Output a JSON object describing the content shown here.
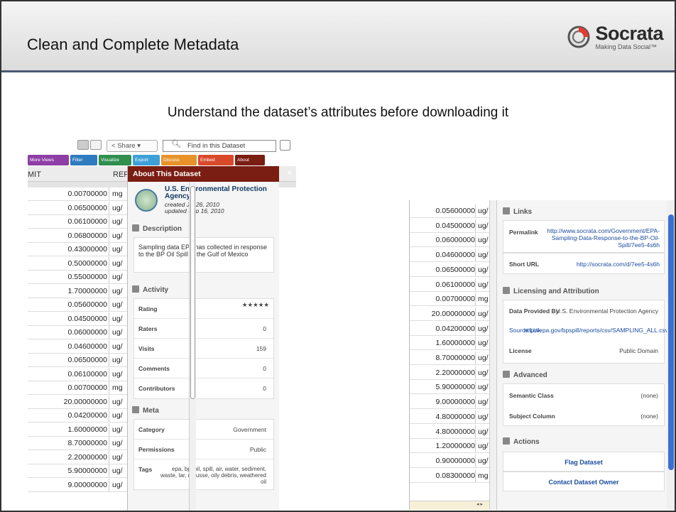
{
  "slide": {
    "title": "Clean and Complete Metadata",
    "subtitle": "Understand the dataset’s attributes before downloading it",
    "logo_name": "Socrata",
    "logo_tagline": "Making Data Social™"
  },
  "left_toolbar": {
    "share_label": "Share ▾",
    "find_placeholder": "Find in this Dataset",
    "buttons": [
      {
        "label": "More Views",
        "color": "#8e3fa5"
      },
      {
        "label": "Filter",
        "color": "#2f7bbf"
      },
      {
        "label": "Visualize",
        "color": "#2f8f4f"
      },
      {
        "label": "Export",
        "color": "#3ea0d8"
      },
      {
        "label": "Discuss",
        "color": "#e8932a"
      },
      {
        "label": "Embed",
        "color": "#d94a2b"
      },
      {
        "label": "About",
        "color": "#7a1d12"
      }
    ]
  },
  "left_table": {
    "col1": "MIT",
    "col2": "REF",
    "rows": [
      {
        "value": "0.00700000",
        "unit": "mg"
      },
      {
        "value": "0.06500000",
        "unit": "ug/"
      },
      {
        "value": "0.06100000",
        "unit": "ug/"
      },
      {
        "value": "0.06800000",
        "unit": "ug/"
      },
      {
        "value": "0.43000000",
        "unit": "ug/"
      },
      {
        "value": "0.50000000",
        "unit": "ug/"
      },
      {
        "value": "0.55000000",
        "unit": "ug/"
      },
      {
        "value": "1.70000000",
        "unit": "ug/"
      },
      {
        "value": "0.05600000",
        "unit": "ug/"
      },
      {
        "value": "0.04500000",
        "unit": "ug/"
      },
      {
        "value": "0.06000000",
        "unit": "ug/"
      },
      {
        "value": "0.04600000",
        "unit": "ug/"
      },
      {
        "value": "0.06500000",
        "unit": "ug/"
      },
      {
        "value": "0.06100000",
        "unit": "ug/"
      },
      {
        "value": "0.00700000",
        "unit": "mg"
      },
      {
        "value": "20.00000000",
        "unit": "ug/"
      },
      {
        "value": "0.04200000",
        "unit": "ug/"
      },
      {
        "value": "1.60000000",
        "unit": "ug/"
      },
      {
        "value": "8.70000000",
        "unit": "ug/"
      },
      {
        "value": "2.20000000",
        "unit": "ug/"
      },
      {
        "value": "5.90000000",
        "unit": "ug/"
      },
      {
        "value": "9.00000000",
        "unit": "ug/"
      }
    ]
  },
  "about": {
    "heading": "About This Dataset",
    "close": "×",
    "agency_name": "U.S. Environmental Protection Agency",
    "created": "created Jul 26, 2010",
    "updated": "updated Sep 16, 2010",
    "description_heading": "Description",
    "description": "Sampling data EPA has collected in response to the BP Oil Spill in the Gulf of Mexico",
    "activity_heading": "Activity",
    "rating_label": "Rating",
    "rating_stars": "★★★★★",
    "raters_label": "Raters",
    "raters": "0",
    "visits_label": "Visits",
    "visits": "159",
    "comments_label": "Comments",
    "comments": "0",
    "contributors_label": "Contributors",
    "contributors": "0",
    "meta_heading": "Meta",
    "category_label": "Category",
    "category": "Government",
    "permissions_label": "Permissions",
    "permissions": "Public",
    "tags_label": "Tags",
    "tags": "epa, bp, oil, spill, air, water, sediment, waste, tar, mousse, oily debris, weathered oil"
  },
  "right_table": {
    "rows": [
      {
        "value": "0.05600000",
        "unit": "ug/"
      },
      {
        "value": "0.04500000",
        "unit": "ug/"
      },
      {
        "value": "0.06000000",
        "unit": "ug/"
      },
      {
        "value": "0.04600000",
        "unit": "ug/"
      },
      {
        "value": "0.06500000",
        "unit": "ug/"
      },
      {
        "value": "0.06100000",
        "unit": "ug/"
      },
      {
        "value": "0.00700000",
        "unit": "mg"
      },
      {
        "value": "20.00000000",
        "unit": "ug/"
      },
      {
        "value": "0.04200000",
        "unit": "ug/"
      },
      {
        "value": "1.60000000",
        "unit": "ug/"
      },
      {
        "value": "8.70000000",
        "unit": "ug/"
      },
      {
        "value": "2.20000000",
        "unit": "ug/"
      },
      {
        "value": "5.90000000",
        "unit": "ug/"
      },
      {
        "value": "9.00000000",
        "unit": "ug/"
      },
      {
        "value": "4.80000000",
        "unit": "ug/"
      },
      {
        "value": "4.80000000",
        "unit": "ug/"
      },
      {
        "value": "1.20000000",
        "unit": "ug/"
      },
      {
        "value": "0.90000000",
        "unit": "ug/"
      },
      {
        "value": "0.08300000",
        "unit": "mg"
      }
    ]
  },
  "right_panel": {
    "links_heading": "Links",
    "permalink_label": "Permalink",
    "permalink": "http://www.socrata.com/Government/EPA-Sampling-Data-Response-to-the-BP-Oil-Spill/7ee5-4s6h",
    "shorturl_label": "Short URL",
    "shorturl": "http://socrata.com/d/7ee5-4s6h",
    "licensing_heading": "Licensing and Attribution",
    "provider_label": "Data Provided By",
    "provider": "U.S. Environmental Protection Agency",
    "source_label": "Source Link",
    "source": "http://epa.gov/bpspill/reports/csv/SAMPLING_ALL.csv",
    "license_label": "License",
    "license": "Public Domain",
    "advanced_heading": "Advanced",
    "semantic_label": "Semantic Class",
    "semantic": "(none)",
    "subject_label": "Subject Column",
    "subject": "(none)",
    "actions_heading": "Actions",
    "flag_label": "Flag Dataset",
    "contact_label": "Contact Dataset Owner"
  }
}
